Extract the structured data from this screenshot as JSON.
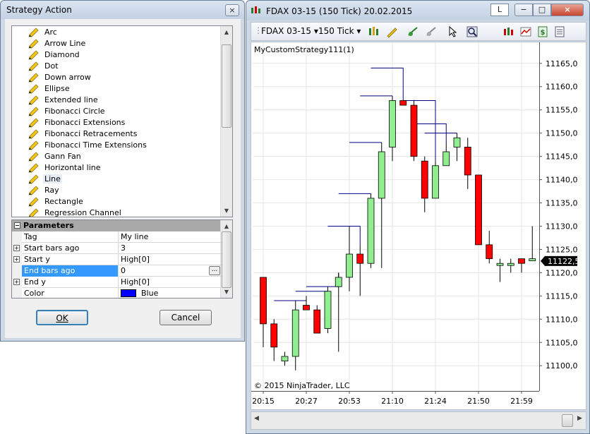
{
  "dialog": {
    "title": "Strategy Action",
    "close_glyph": "×",
    "tools": [
      {
        "label": "Arc",
        "icon": "pencil-icon"
      },
      {
        "label": "Arrow Line",
        "icon": "pencil-icon"
      },
      {
        "label": "Diamond",
        "icon": "pencil-icon"
      },
      {
        "label": "Dot",
        "icon": "pencil-icon"
      },
      {
        "label": "Down arrow",
        "icon": "pencil-icon"
      },
      {
        "label": "Ellipse",
        "icon": "pencil-icon"
      },
      {
        "label": "Extended line",
        "icon": "pencil-icon"
      },
      {
        "label": "Fibonacci Circle",
        "icon": "pencil-icon"
      },
      {
        "label": "Fibonacci Extensions",
        "icon": "pencil-icon"
      },
      {
        "label": "Fibonacci Retracements",
        "icon": "pencil-icon"
      },
      {
        "label": "Fibonacci Time Extensions",
        "icon": "pencil-icon"
      },
      {
        "label": "Gann Fan",
        "icon": "pencil-icon"
      },
      {
        "label": "Horizontal line",
        "icon": "pencil-icon"
      },
      {
        "label": "Line",
        "icon": "pencil-icon",
        "selected": true
      },
      {
        "label": "Ray",
        "icon": "pencil-icon"
      },
      {
        "label": "Rectangle",
        "icon": "pencil-icon"
      },
      {
        "label": "Regression Channel",
        "icon": "pencil-icon"
      }
    ],
    "parameters": {
      "header": "Parameters",
      "collapse_glyph": "−",
      "rows": [
        {
          "name": "Tag",
          "value": "My line",
          "expandable": false
        },
        {
          "name": "Start bars ago",
          "value": "3",
          "expandable": true
        },
        {
          "name": "Start y",
          "value": "High[0]",
          "expandable": true
        },
        {
          "name": "End bars ago",
          "value": "0",
          "expandable": false,
          "selected": true
        },
        {
          "name": "End y",
          "value": "High[0]",
          "expandable": true
        },
        {
          "name": "Color",
          "value": "Blue",
          "expandable": false,
          "color": "#0000ff"
        }
      ],
      "expand_glyph": "+",
      "ellipsis_label": "..."
    },
    "ok_label": "OK",
    "cancel_label": "Cancel"
  },
  "chart_window": {
    "title": "FDAX 03-15 (150 Tick)  20.02.2015",
    "link_button": "L",
    "minimize_glyph": "−",
    "maximize_glyph": "□",
    "close_glyph": "×",
    "toolbar": {
      "instrument": "FDAX 03-15",
      "interval": "150 Tick",
      "dropdown_glyph": "▾"
    },
    "strategy_label": "MyCustomStrategy111(1)",
    "copyright": "© 2015 NinjaTrader, LLC",
    "price_marker": "11122,5",
    "scroll_left": "◀",
    "scroll_right": "▶"
  },
  "chart_data": {
    "type": "candlestick",
    "y_range": [
      11097,
      11168
    ],
    "y_ticks": [
      11100,
      11105,
      11110,
      11115,
      11120,
      11125,
      11130,
      11135,
      11140,
      11145,
      11150,
      11155,
      11160,
      11165
    ],
    "y_tick_labels": [
      "11100,0",
      "11105,0",
      "11110,0",
      "11115,0",
      "11120,0",
      "11125,0",
      "11130,0",
      "11135,0",
      "11140,0",
      "11145,0",
      "11150,0",
      "11155,0",
      "11160,0",
      "11165,0"
    ],
    "x_tick_labels": [
      "20:15",
      "20:27",
      "20:53",
      "21:10",
      "21:24",
      "21:50",
      "21:59"
    ],
    "x_tick_bar_index": [
      0,
      4,
      8,
      12,
      16,
      20,
      24
    ],
    "current_price": 11122.5,
    "up_color": "#90ee90",
    "down_color": "#ff0000",
    "line_color": "#000080",
    "candles": [
      {
        "o": 11119,
        "h": 11119,
        "l": 11104,
        "c": 11109
      },
      {
        "o": 11109,
        "h": 11110,
        "l": 11101,
        "c": 11104
      },
      {
        "o": 11101,
        "h": 11103,
        "l": 11100,
        "c": 11102
      },
      {
        "o": 11102,
        "h": 11114,
        "l": 11099,
        "c": 11112
      },
      {
        "o": 11113,
        "h": 11115,
        "l": 11112,
        "c": 11112
      },
      {
        "o": 11112,
        "h": 11113,
        "l": 11107,
        "c": 11107
      },
      {
        "o": 11108,
        "h": 11117,
        "l": 11107,
        "c": 11116
      },
      {
        "o": 11117,
        "h": 11120,
        "l": 11103,
        "c": 11119
      },
      {
        "o": 11119,
        "h": 11130,
        "l": 11116,
        "c": 11124
      },
      {
        "o": 11124,
        "h": 11126,
        "l": 11115,
        "c": 11122
      },
      {
        "o": 11122,
        "h": 11137,
        "l": 11121,
        "c": 11136
      },
      {
        "o": 11136,
        "h": 11148,
        "l": 11121,
        "c": 11146
      },
      {
        "o": 11147,
        "h": 11158,
        "l": 11144,
        "c": 11157
      },
      {
        "o": 11157,
        "h": 11157,
        "l": 11156,
        "c": 11156
      },
      {
        "o": 11156,
        "h": 11157,
        "l": 11144,
        "c": 11145
      },
      {
        "o": 11144,
        "h": 11145,
        "l": 11133,
        "c": 11136
      },
      {
        "o": 11136,
        "h": 11144,
        "l": 11136,
        "c": 11143
      },
      {
        "o": 11143,
        "h": 11148,
        "l": 11143,
        "c": 11146
      },
      {
        "o": 11147,
        "h": 11150,
        "l": 11144,
        "c": 11149
      },
      {
        "o": 11147,
        "h": 11149,
        "l": 11138,
        "c": 11141
      },
      {
        "o": 11141,
        "h": 11141,
        "l": 11126,
        "c": 11126
      },
      {
        "o": 11126,
        "h": 11129,
        "l": 11122,
        "c": 11123
      },
      {
        "o": 11122,
        "h": 11123,
        "l": 11118,
        "c": 11122
      },
      {
        "o": 11122,
        "h": 11123,
        "l": 11120,
        "c": 11122
      },
      {
        "o": 11123,
        "h": 11123,
        "l": 11120,
        "c": 11122
      },
      {
        "o": 11123,
        "h": 11130,
        "l": 11123,
        "c": 11123
      }
    ],
    "drawn_lines": [
      {
        "from_bar": 1,
        "to_bar": 4,
        "y": 11114
      },
      {
        "from_bar": 3,
        "to_bar": 6,
        "y": 11116
      },
      {
        "from_bar": 4,
        "to_bar": 7,
        "y": 11117
      },
      {
        "from_bar": 6,
        "to_bar": 9,
        "y": 11130
      },
      {
        "from_bar": 7,
        "to_bar": 10,
        "y": 11137
      },
      {
        "from_bar": 8,
        "to_bar": 11,
        "y": 11148
      },
      {
        "from_bar": 9,
        "to_bar": 12,
        "y": 11158
      },
      {
        "from_bar": 10,
        "to_bar": 13,
        "y": 11164
      },
      {
        "from_bar": 13,
        "to_bar": 16,
        "y": 11157
      },
      {
        "from_bar": 14,
        "to_bar": 17,
        "y": 11152
      },
      {
        "from_bar": 15,
        "to_bar": 18,
        "y": 11150
      }
    ]
  }
}
